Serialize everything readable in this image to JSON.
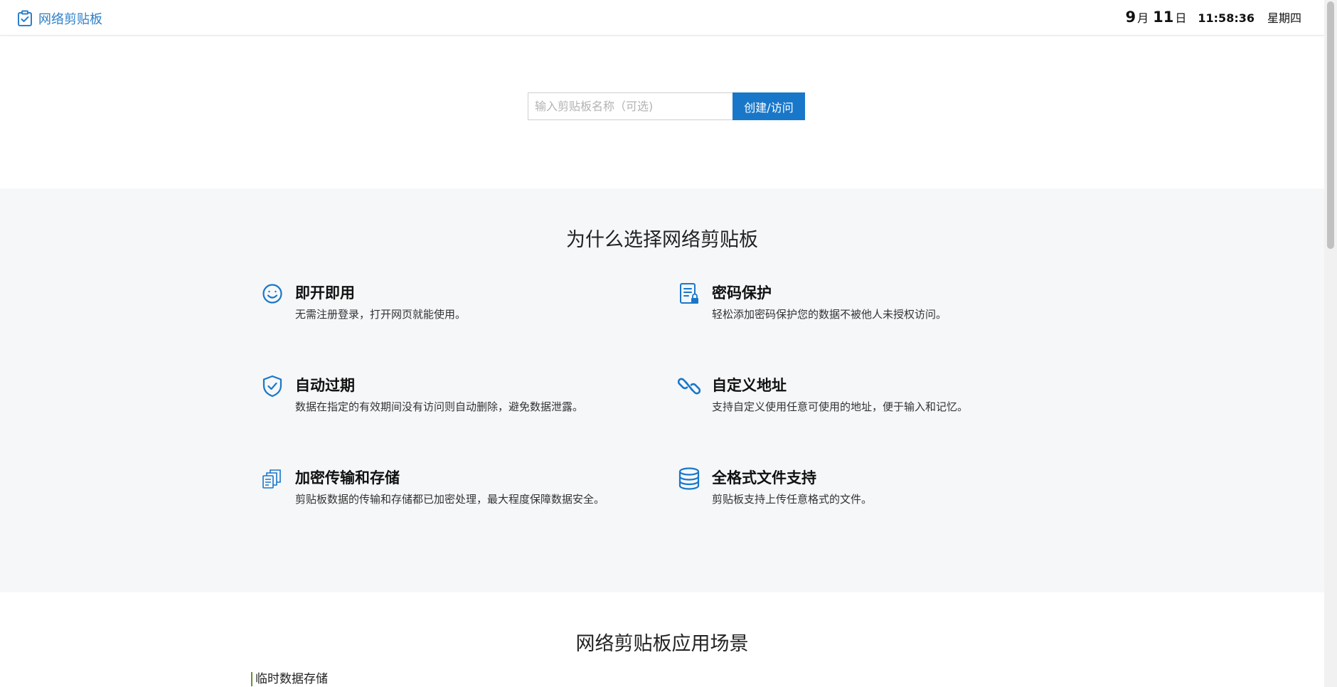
{
  "header": {
    "brand": "网络剪贴板",
    "date": {
      "month": "9",
      "month_unit": "月",
      "day": "11",
      "day_unit": "日",
      "time": "11:58:36",
      "weekday": "星期四"
    }
  },
  "search": {
    "placeholder": "输入剪贴板名称（可选)",
    "button_label": "创建/访问"
  },
  "features": {
    "title": "为什么选择网络剪贴板",
    "items": [
      {
        "icon": "smile-icon",
        "title": "即开即用",
        "desc": "无需注册登录，打开网页就能使用。"
      },
      {
        "icon": "password-lock-icon",
        "title": "密码保护",
        "desc": "轻松添加密码保护您的数据不被他人未授权访问。"
      },
      {
        "icon": "shield-check-icon",
        "title": "自动过期",
        "desc": "数据在指定的有效期间没有访问则自动删除，避免数据泄露。"
      },
      {
        "icon": "link-icon",
        "title": "自定义地址",
        "desc": "支持自定义使用任意可使用的地址，便于输入和记忆。"
      },
      {
        "icon": "copy-files-icon",
        "title": "加密传输和存储",
        "desc": "剪贴板数据的传输和存储都已加密处理，最大程度保障数据安全。"
      },
      {
        "icon": "database-icon",
        "title": "全格式文件支持",
        "desc": "剪贴板支持上传任意格式的文件。"
      }
    ]
  },
  "scenarios": {
    "title": "网络剪贴板应用场景",
    "items": [
      "临时数据存储"
    ]
  },
  "colors": {
    "brand": "#2d7fc8",
    "button": "#1977c9",
    "section_bg": "#f5f7f9"
  }
}
